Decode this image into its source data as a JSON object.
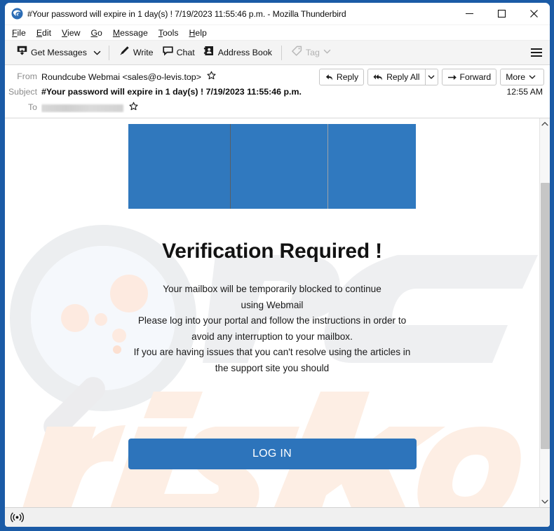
{
  "window": {
    "title": "#Your password will expire in 1 day(s) ! 7/19/2023 11:55:46 p.m. - Mozilla Thunderbird",
    "app_icon": "thunderbird-icon",
    "controls": {
      "minimize": "minimize-icon",
      "maximize": "maximize-icon",
      "close": "close-icon"
    },
    "border_color": "#1b5ba6"
  },
  "menu": {
    "items": [
      {
        "label": "File",
        "access": "F"
      },
      {
        "label": "Edit",
        "access": "E"
      },
      {
        "label": "View",
        "access": "V"
      },
      {
        "label": "Go",
        "access": "G"
      },
      {
        "label": "Message",
        "access": "M"
      },
      {
        "label": "Tools",
        "access": "T"
      },
      {
        "label": "Help",
        "access": "H"
      }
    ]
  },
  "toolbar": {
    "get_messages": "Get Messages",
    "write": "Write",
    "chat": "Chat",
    "address_book": "Address Book",
    "tag": "Tag",
    "app_menu": "hamburger-menu-icon"
  },
  "message_header": {
    "from_label": "From",
    "from_value": "Roundcube Webmai <sales@o-levis.top>",
    "subject_label": "Subject",
    "subject_value": "#Your password will expire in 1 day(s) ! 7/19/2023 11:55:46 p.m.",
    "to_label": "To",
    "to_value": "",
    "to_redacted": true,
    "time": "12:55 AM",
    "actions": {
      "reply": "Reply",
      "reply_all": "Reply All",
      "forward": "Forward",
      "more": "More"
    }
  },
  "body": {
    "banner_alt": "broken-image-banner",
    "headline": "Verification Required !",
    "paragraph_lines": [
      "Your mailbox will be temporarily blocked  to continue",
      "using  Webmail",
      "Please log into your portal and follow the instructions in order to",
      "avoid any interruption to your mailbox.",
      "If you are having issues that you can't resolve using the articles in",
      "the support site you should"
    ],
    "login_button": "LOG IN",
    "accent_color": "#2d74bb",
    "banner_color": "#3079bf"
  },
  "watermark": {
    "text_gray": "PC",
    "text_orange": "risk.com",
    "gray": "#eeeeef",
    "orange": "#fdeee4"
  },
  "status_bar": {
    "icon": "broadcast-icon"
  },
  "scrollbar": {
    "up": "chevron-up-icon",
    "down": "chevron-down-icon"
  }
}
